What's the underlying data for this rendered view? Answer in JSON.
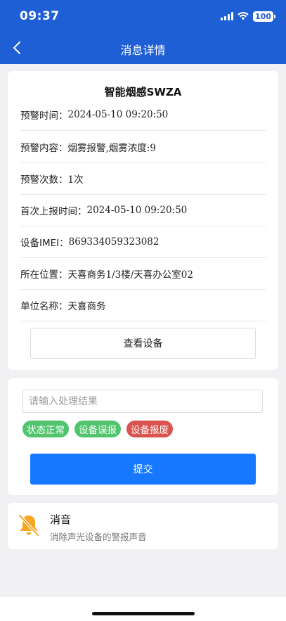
{
  "status_bar": {
    "time": "09:37",
    "battery": "100",
    "icons": [
      "signal-icon",
      "wifi-icon",
      "battery-icon"
    ]
  },
  "nav": {
    "back_icon": "chevron-left-icon",
    "title": "消息详情"
  },
  "detail": {
    "title": "智能烟感SWZA",
    "rows": [
      {
        "label": "预警时间：",
        "value": "2024-05-10 09:20:50"
      },
      {
        "label": "预警内容：",
        "value": "烟雾报警,烟雾浓度:9"
      },
      {
        "label": "预警次数：",
        "value": "1次"
      },
      {
        "label": "首次上报时间：",
        "value": "2024-05-10 09:20:50"
      },
      {
        "label": "设备IMEI：",
        "value": "869334059323082"
      },
      {
        "label": "所在位置：",
        "value": "天喜商务1/3楼/天喜办公室02"
      },
      {
        "label": "单位名称：",
        "value": "天喜商务"
      }
    ],
    "view_device_label": "查看设备"
  },
  "process": {
    "input_placeholder": "请输入处理结果",
    "input_value": "",
    "tags": [
      {
        "label": "状态正常",
        "color": "#52c46e"
      },
      {
        "label": "设备误报",
        "color": "#52c46e"
      },
      {
        "label": "设备报废",
        "color": "#d9534f"
      }
    ],
    "submit_label": "提交"
  },
  "mute": {
    "icon": "bell-off-icon",
    "title": "消音",
    "subtitle": "消除声光设备的警报声音"
  },
  "colors": {
    "header": "#1f5fd6",
    "primary_button": "#1677ff",
    "mute_icon": "#f5a623"
  }
}
